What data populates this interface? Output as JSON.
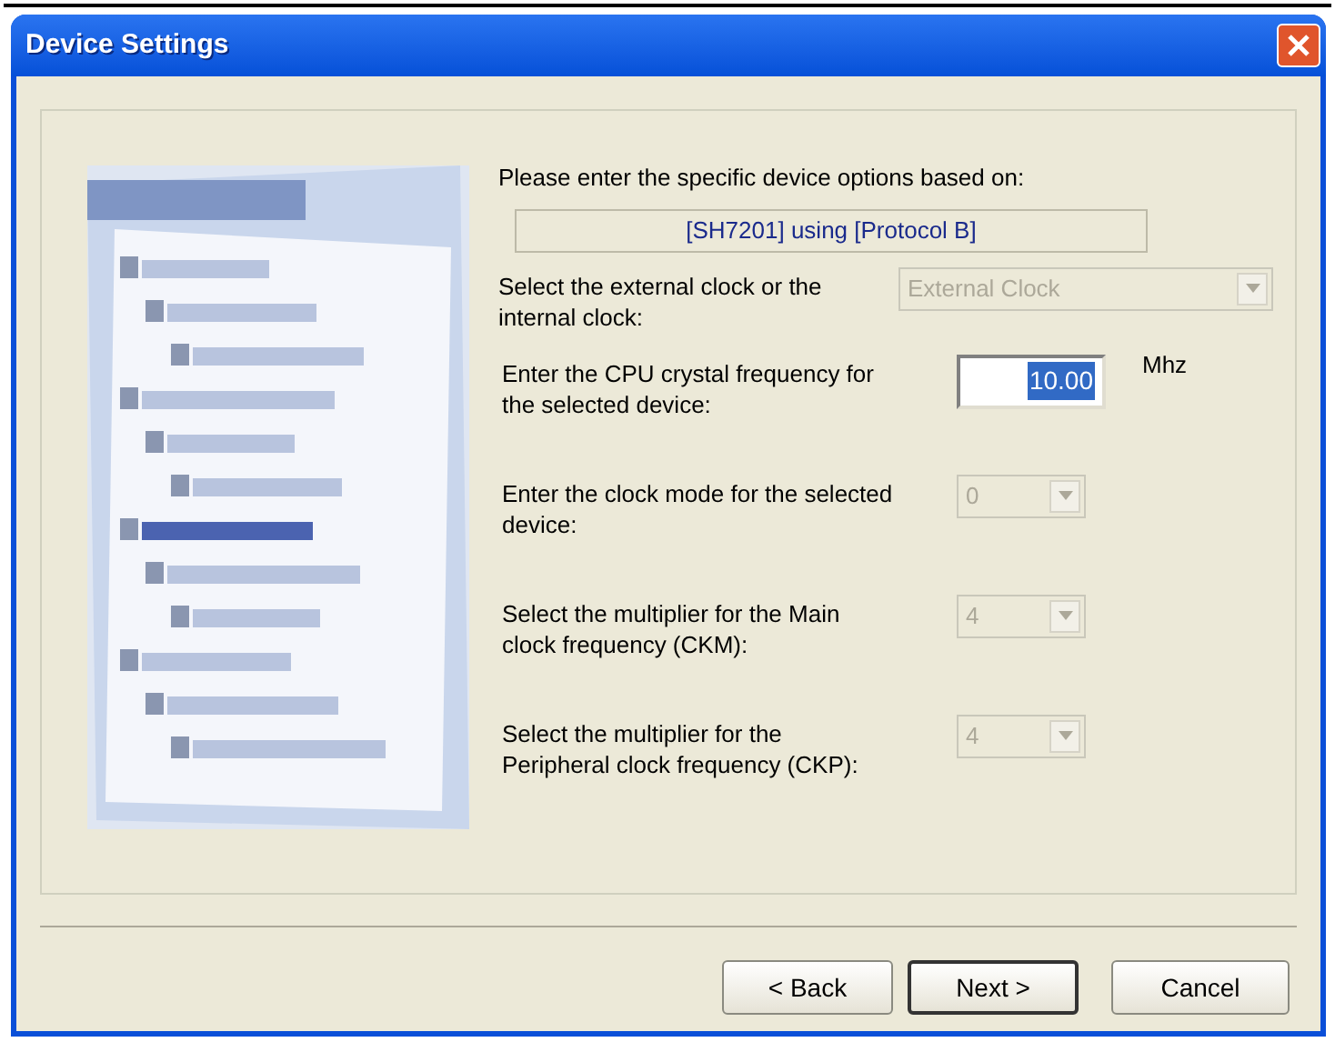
{
  "window": {
    "title": "Device Settings"
  },
  "intro": "Please enter the specific device options based on:",
  "device_line": "[SH7201]  using  [Protocol B]",
  "settings": [
    {
      "kind": "combo",
      "label": "Select the external clock or the internal clock:",
      "value": "External Clock",
      "disabled": true,
      "wide": true
    },
    {
      "kind": "text",
      "label": "Enter the CPU crystal frequency for the selected device:",
      "value": "10.00",
      "unit": "Mhz",
      "selected": true
    },
    {
      "kind": "combo",
      "label": "Enter the clock mode for the selected device:",
      "value": "0",
      "disabled": true
    },
    {
      "kind": "combo",
      "label": "Select the multiplier for the Main clock frequency (CKM):",
      "value": "4",
      "disabled": true
    },
    {
      "kind": "combo",
      "label": "Select the multiplier for the Peripheral clock frequency (CKP):",
      "value": "4",
      "disabled": true
    }
  ],
  "buttons": [
    {
      "label": "< Back",
      "default": false
    },
    {
      "label": "Next >",
      "default": true
    },
    {
      "label": "Cancel",
      "default": false
    }
  ]
}
